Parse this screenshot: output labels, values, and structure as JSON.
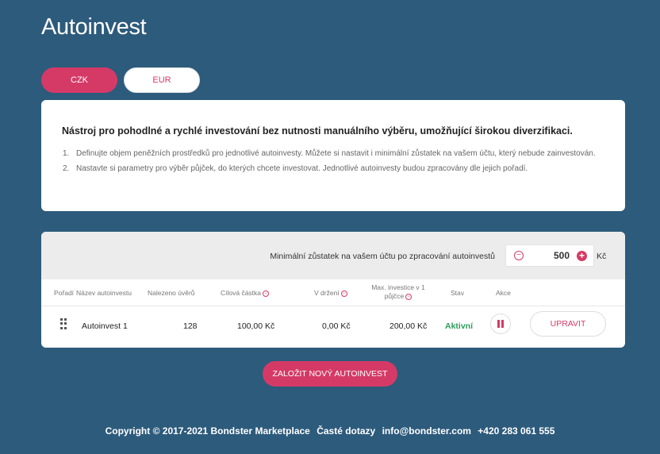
{
  "page": {
    "title": "Autoinvest"
  },
  "currency_tabs": [
    {
      "label": "CZK",
      "active": true
    },
    {
      "label": "EUR",
      "active": false
    }
  ],
  "info": {
    "title": "Nástroj pro pohodlné a rychlé investování bez nutnosti manuálního výběru, umožňující širokou diverzifikaci.",
    "items": [
      {
        "num": "1.",
        "text": "Definujte objem peněžních prostředků pro jednotlivé autoinvesty. Můžete si nastavit i minimální zůstatek na vašem účtu, který nebude zainvestován."
      },
      {
        "num": "2.",
        "text": "Nastavte si parametry pro výběr půjček, do kterých chcete investovat. Jednotlivé autoinvesty budou zpracovány dle jejich pořadí."
      }
    ]
  },
  "balance": {
    "label": "Minimální zůstatek na vašem účtu po zpracování autoinvestů",
    "value": "500",
    "unit": "Kč",
    "minus": "−",
    "plus": "+"
  },
  "table": {
    "headers": {
      "order": "Pořadí",
      "name": "Název autoinvestu",
      "found": "Nalezeno úvěrů",
      "target": "Cílová částka",
      "holding": "V držení",
      "max_line1": "Max. investice v 1",
      "max_line2": "půjčce",
      "status": "Stav",
      "action": "Akce"
    },
    "rows": [
      {
        "name": "Autoinvest 1",
        "found": "128",
        "target": "100,00 Kč",
        "holding": "0,00 Kč",
        "max": "200,00 Kč",
        "status": "Aktivní",
        "edit_label": "UPRAVIT"
      }
    ]
  },
  "new_button": "ZALOŽIT NOVÝ AUTOINVEST",
  "footer": {
    "copyright": "Copyright © 2017-2021 Bondster Marketplace",
    "faq": "Časté dotazy",
    "email": "info@bondster.com",
    "phone": "+420 283 061 555"
  },
  "colors": {
    "background": "#2d5b7c",
    "accent": "#d53a67",
    "active_status": "#2c9c5a"
  }
}
